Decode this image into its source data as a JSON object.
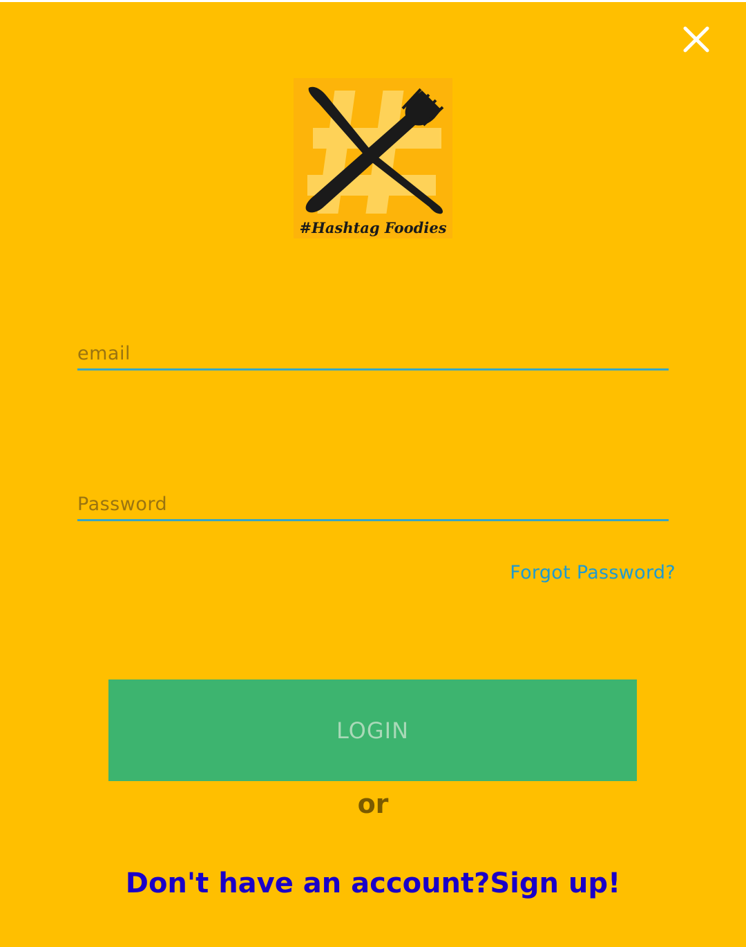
{
  "header": {
    "close_icon": "close-icon"
  },
  "logo": {
    "text": "#Hashtag Foodies",
    "icon": "crossed-knife-fork-hashtag-logo"
  },
  "form": {
    "email": {
      "value": "",
      "placeholder": "email"
    },
    "password": {
      "value": "",
      "placeholder": "Password"
    },
    "forgot_password": "Forgot Password?",
    "login_label": "LOGIN",
    "or_label": "or",
    "signup_label": "Don't have an account?Sign up!"
  },
  "colors": {
    "background": "#FFBF00",
    "accent_underline": "#35A6C6",
    "login_button": "#3DB46F",
    "link": "#1E9AD0",
    "signup": "#1A00C8"
  }
}
